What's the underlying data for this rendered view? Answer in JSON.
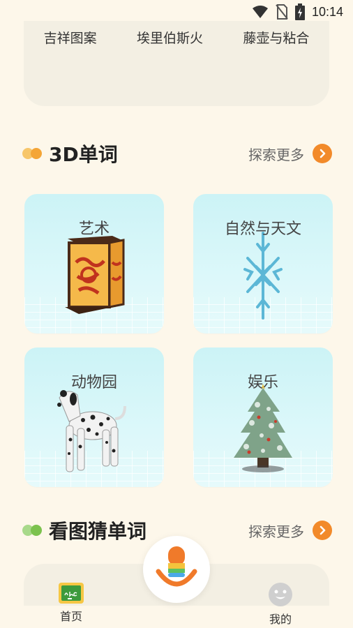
{
  "status_bar": {
    "time": "10:14"
  },
  "top_card": {
    "labels": [
      "吉祥图案",
      "埃里伯斯火",
      "藤壶与粘合"
    ]
  },
  "sections": {
    "words_3d": {
      "title": "3D单词",
      "more": "探索更多"
    },
    "guess_words": {
      "title": "看图猜单词",
      "more": "探索更多"
    }
  },
  "cards": [
    {
      "label": "艺术"
    },
    {
      "label": "自然与天文"
    },
    {
      "label": "动物园"
    },
    {
      "label": "娱乐"
    }
  ],
  "tabbar": {
    "home": "首页",
    "mine": "我的"
  },
  "colors": {
    "background": "#fdf7ea",
    "accent_orange": "#f28a2a",
    "card_cyan": "#ccf3f6"
  }
}
